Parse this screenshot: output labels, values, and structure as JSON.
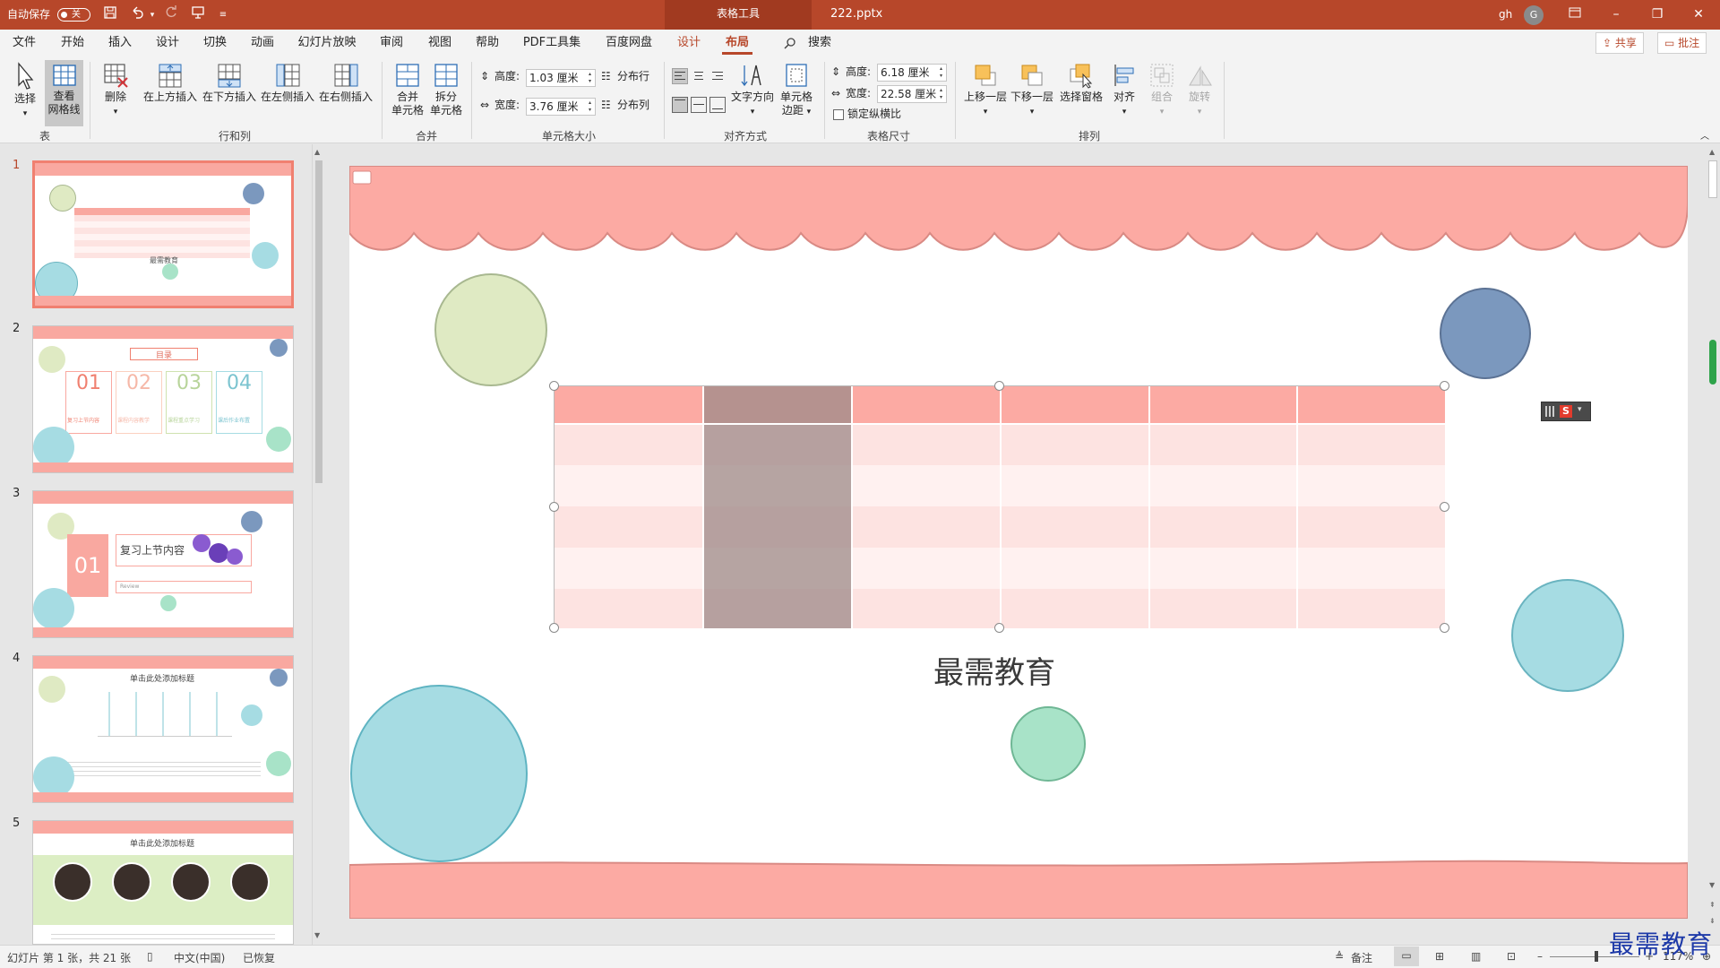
{
  "titlebar": {
    "autosave_label": "自动保存",
    "autosave_state": "关",
    "context_tab": "表格工具",
    "filename": "222.pptx",
    "user": "gh",
    "avatar_initial": "G"
  },
  "menu": {
    "tabs": [
      "文件",
      "开始",
      "插入",
      "设计",
      "切换",
      "动画",
      "幻灯片放映",
      "审阅",
      "视图",
      "帮助",
      "PDF工具集",
      "百度网盘",
      "设计",
      "布局"
    ],
    "search": "搜索",
    "share": "共享",
    "comments": "批注"
  },
  "ribbon": {
    "group_table": {
      "label": "表",
      "select": "选择",
      "gridlines_1": "查看",
      "gridlines_2": "网格线"
    },
    "group_rowcol": {
      "label": "行和列",
      "delete": "删除",
      "insert_above": "在上方插入",
      "insert_below": "在下方插入",
      "insert_left": "在左侧插入",
      "insert_right": "在右侧插入"
    },
    "group_merge": {
      "label": "合并",
      "merge_1": "合并",
      "merge_2": "单元格",
      "split_1": "拆分",
      "split_2": "单元格"
    },
    "group_cellsize": {
      "label": "单元格大小",
      "height_label": "高度:",
      "height_value": "1.03 厘米",
      "width_label": "宽度:",
      "width_value": "3.76 厘米",
      "dist_rows": "分布行",
      "dist_cols": "分布列"
    },
    "group_align": {
      "label": "对齐方式",
      "text_dir": "文字方向",
      "margins_1": "单元格",
      "margins_2": "边距"
    },
    "group_tablesize": {
      "label": "表格尺寸",
      "height_label": "高度:",
      "height_value": "6.18 厘米",
      "width_label": "宽度:",
      "width_value": "22.58 厘米",
      "lock_ratio": "锁定纵横比"
    },
    "group_arrange": {
      "label": "排列",
      "bring_forward": "上移一层",
      "send_backward": "下移一层",
      "selection_pane": "选择窗格",
      "align": "对齐",
      "group": "组合",
      "rotate": "旋转"
    }
  },
  "thumbnails": {
    "numbers": [
      "1",
      "2",
      "3",
      "4",
      "5"
    ],
    "slide1_caption": "最需教育",
    "slide2_title": "目录",
    "slide2_nums": [
      "01",
      "02",
      "03",
      "04"
    ],
    "slide2_items": [
      "复习上节内容",
      "课程内容教学",
      "课程重点学习",
      "课后作业布置"
    ],
    "slide3_num": "01",
    "slide3_title": "复习上节内容",
    "slide3_sub": "Review",
    "slide4_title": "单击此处添加标题",
    "slide5_title": "单击此处添加标题"
  },
  "slide": {
    "caption": "最需教育",
    "table_rows": 6,
    "table_cols": 6
  },
  "statusbar": {
    "slide_info": "幻灯片 第 1 张，共 21 张",
    "language": "中文(中国)",
    "recovered": "已恢复",
    "notes": "备注",
    "zoom": "117%"
  },
  "watermark": "最需教育",
  "colors": {
    "accent": "#b7472a",
    "pink": "#f9a8a0",
    "light_pink": "#fde3e1",
    "selected_col": "#b59a98"
  }
}
